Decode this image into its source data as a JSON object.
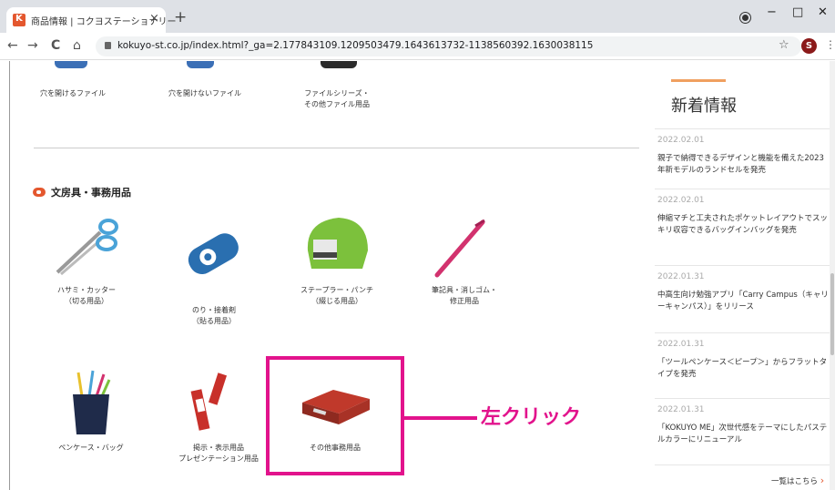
{
  "browser": {
    "tab_title": "商品情報 | コクヨステーショナリー",
    "tab_close": "×",
    "new_tab": "+",
    "back": "←",
    "forward": "→",
    "reload": "C",
    "home": "⌂",
    "url": "kokuyo-st.co.jp/index.html?_ga=2.177843109.1209503479.1643613732-1138560392.1630038115",
    "bookmark_star": "☆",
    "avatar_letter": "S",
    "menu_dots": "⋮",
    "minimize": "−",
    "maximize": "□",
    "close": "✕"
  },
  "file_categories": [
    {
      "label": "穴を開けるファイル"
    },
    {
      "label": "穴を開けないファイル"
    },
    {
      "label": "ファイルシリーズ・\nその他ファイル用品"
    }
  ],
  "stationery_section": {
    "title": "文房具・事務用品",
    "products": [
      {
        "label": "ハサミ・カッター\n（切る用品）"
      },
      {
        "label": "のり・接着剤\n（貼る用品）"
      },
      {
        "label": "ステープラー・パンチ\n（綴じる用品）"
      },
      {
        "label": "筆記具・消しゴム・\n修正用品"
      },
      {
        "label": "ペンケース・バッグ"
      },
      {
        "label": "掲示・表示用品\nプレゼンテーション用品"
      },
      {
        "label": "その他事務用品"
      }
    ]
  },
  "annotation": {
    "click_label": "左クリック",
    "color": "#e2138c"
  },
  "news": {
    "heading": "新着情報",
    "items": [
      {
        "date": "2022.02.01",
        "text": "親子で納得できるデザインと機能を備えた2023年新モデルのランドセルを発売"
      },
      {
        "date": "2022.02.01",
        "text": "伸縮マチと工夫されたポケットレイアウトでスッキリ収容できるバッグインバッグを発売"
      },
      {
        "date": "2022.01.31",
        "text": "中高生向け勉強アプリ「Carry Campus（キャリーキャンパス）」をリリース"
      },
      {
        "date": "2022.01.31",
        "text": "「ツールペンケース＜ピープ＞」からフラットタイプを発売"
      },
      {
        "date": "2022.01.31",
        "text": "「KOKUYO ME」次世代感をテーマにしたパステルカラーにリニューアル"
      }
    ],
    "more_link": "一覧はこちら",
    "more_chevron": "›"
  },
  "colors": {
    "brand": "#e4572e",
    "highlight": "#e2138c"
  }
}
